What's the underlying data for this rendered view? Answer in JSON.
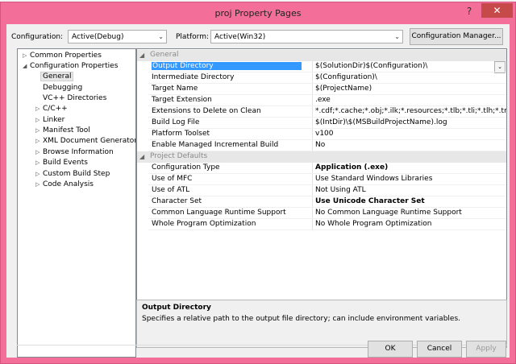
{
  "window": {
    "title": "proj Property Pages",
    "help_glyph": "?",
    "close_glyph": "✕"
  },
  "toolbar": {
    "configuration_label": "Configuration:",
    "configuration_value": "Active(Debug)",
    "platform_label": "Platform:",
    "platform_value": "Active(Win32)",
    "config_manager_label": "Configuration Manager..."
  },
  "tree": {
    "items": [
      {
        "label": "Common Properties",
        "expander": "▷"
      },
      {
        "label": "Configuration Properties",
        "expander": "◢"
      },
      {
        "label": "General",
        "expander": ""
      },
      {
        "label": "Debugging",
        "expander": ""
      },
      {
        "label": "VC++ Directories",
        "expander": ""
      },
      {
        "label": "C/C++",
        "expander": "▷"
      },
      {
        "label": "Linker",
        "expander": "▷"
      },
      {
        "label": "Manifest Tool",
        "expander": "▷"
      },
      {
        "label": "XML Document Generator",
        "expander": "▷"
      },
      {
        "label": "Browse Information",
        "expander": "▷"
      },
      {
        "label": "Build Events",
        "expander": "▷"
      },
      {
        "label": "Custom Build Step",
        "expander": "▷"
      },
      {
        "label": "Code Analysis",
        "expander": "▷"
      }
    ]
  },
  "grid": {
    "general": {
      "label": "General",
      "rows": [
        {
          "name": "Output Directory",
          "value": "$(SolutionDir)$(Configuration)\\"
        },
        {
          "name": "Intermediate Directory",
          "value": "$(Configuration)\\"
        },
        {
          "name": "Target Name",
          "value": "$(ProjectName)"
        },
        {
          "name": "Target Extension",
          "value": ".exe"
        },
        {
          "name": "Extensions to Delete on Clean",
          "value": "*.cdf;*.cache;*.obj;*.ilk;*.resources;*.tlb;*.tli;*.tlh;*.tmp;*.rsp;"
        },
        {
          "name": "Build Log File",
          "value": "$(IntDir)\\$(MSBuildProjectName).log"
        },
        {
          "name": "Platform Toolset",
          "value": "v100"
        },
        {
          "name": "Enable Managed Incremental Build",
          "value": "No"
        }
      ]
    },
    "defaults": {
      "label": "Project Defaults",
      "rows": [
        {
          "name": "Configuration Type",
          "value": "Application (.exe)"
        },
        {
          "name": "Use of MFC",
          "value": "Use Standard Windows Libraries"
        },
        {
          "name": "Use of ATL",
          "value": "Not Using ATL"
        },
        {
          "name": "Character Set",
          "value": "Use Unicode Character Set"
        },
        {
          "name": "Common Language Runtime Support",
          "value": "No Common Language Runtime Support"
        },
        {
          "name": "Whole Program Optimization",
          "value": "No Whole Program Optimization"
        }
      ]
    }
  },
  "description": {
    "title": "Output Directory",
    "text": "Specifies a relative path to the output file directory; can include environment variables."
  },
  "buttons": {
    "ok": "OK",
    "cancel": "Cancel",
    "apply": "Apply"
  },
  "colors": {
    "frame": "#f36f9a",
    "close": "#c74a4a",
    "selection": "#3399ff"
  }
}
